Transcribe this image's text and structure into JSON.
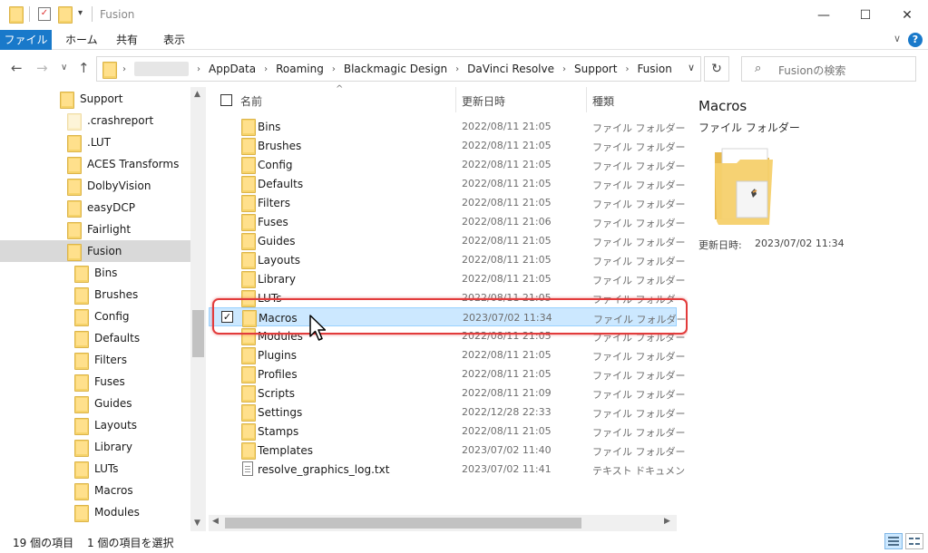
{
  "window": {
    "title": "Fusion",
    "minimize_glyph": "—",
    "maximize_glyph": "☐",
    "close_glyph": "✕"
  },
  "ribbon": {
    "tabs": [
      "ファイル",
      "ホーム",
      "共有",
      "表示"
    ],
    "help_glyph": "?",
    "expand_glyph": "∨"
  },
  "address": {
    "back_glyph": "←",
    "forward_glyph": "→",
    "recent_glyph": "∨",
    "up_glyph": "↑",
    "crumbs": [
      "AppData",
      "Roaming",
      "Blackmagic Design",
      "DaVinci Resolve",
      "Support",
      "Fusion"
    ],
    "crumb_separator": "›",
    "dropdown_glyph": "∨",
    "refresh_glyph": "↻"
  },
  "search": {
    "icon_glyph": "⌕",
    "placeholder": "Fusionの検索"
  },
  "nav": {
    "items": [
      {
        "label": "Support",
        "level": 0,
        "selected": false,
        "faint": false
      },
      {
        "label": ".crashreport",
        "level": 1,
        "selected": false,
        "faint": true
      },
      {
        "label": ".LUT",
        "level": 1,
        "selected": false,
        "faint": false
      },
      {
        "label": "ACES Transforms",
        "level": 1,
        "selected": false,
        "faint": false
      },
      {
        "label": "DolbyVision",
        "level": 1,
        "selected": false,
        "faint": false
      },
      {
        "label": "easyDCP",
        "level": 1,
        "selected": false,
        "faint": false
      },
      {
        "label": "Fairlight",
        "level": 1,
        "selected": false,
        "faint": false
      },
      {
        "label": "Fusion",
        "level": 1,
        "selected": true,
        "faint": false
      },
      {
        "label": "Bins",
        "level": 2,
        "selected": false,
        "faint": false
      },
      {
        "label": "Brushes",
        "level": 2,
        "selected": false,
        "faint": false
      },
      {
        "label": "Config",
        "level": 2,
        "selected": false,
        "faint": false
      },
      {
        "label": "Defaults",
        "level": 2,
        "selected": false,
        "faint": false
      },
      {
        "label": "Filters",
        "level": 2,
        "selected": false,
        "faint": false
      },
      {
        "label": "Fuses",
        "level": 2,
        "selected": false,
        "faint": false
      },
      {
        "label": "Guides",
        "level": 2,
        "selected": false,
        "faint": false
      },
      {
        "label": "Layouts",
        "level": 2,
        "selected": false,
        "faint": false
      },
      {
        "label": "Library",
        "level": 2,
        "selected": false,
        "faint": false
      },
      {
        "label": "LUTs",
        "level": 2,
        "selected": false,
        "faint": false
      },
      {
        "label": "Macros",
        "level": 2,
        "selected": false,
        "faint": false
      },
      {
        "label": "Modules",
        "level": 2,
        "selected": false,
        "faint": false
      }
    ],
    "scroll_up_glyph": "▲",
    "scroll_down_glyph": "▼"
  },
  "list": {
    "columns": {
      "name": "名前",
      "date": "更新日時",
      "type": "種類"
    },
    "sort_glyph": "^",
    "check_glyph": "✓",
    "rows": [
      {
        "name": "Bins",
        "date": "2022/08/11 21:05",
        "type": "ファイル フォルダー",
        "icon": "folder",
        "selected": false
      },
      {
        "name": "Brushes",
        "date": "2022/08/11 21:05",
        "type": "ファイル フォルダー",
        "icon": "folder",
        "selected": false
      },
      {
        "name": "Config",
        "date": "2022/08/11 21:05",
        "type": "ファイル フォルダー",
        "icon": "folder",
        "selected": false
      },
      {
        "name": "Defaults",
        "date": "2022/08/11 21:05",
        "type": "ファイル フォルダー",
        "icon": "folder",
        "selected": false
      },
      {
        "name": "Filters",
        "date": "2022/08/11 21:05",
        "type": "ファイル フォルダー",
        "icon": "folder",
        "selected": false
      },
      {
        "name": "Fuses",
        "date": "2022/08/11 21:06",
        "type": "ファイル フォルダー",
        "icon": "folder",
        "selected": false
      },
      {
        "name": "Guides",
        "date": "2022/08/11 21:05",
        "type": "ファイル フォルダー",
        "icon": "folder",
        "selected": false
      },
      {
        "name": "Layouts",
        "date": "2022/08/11 21:05",
        "type": "ファイル フォルダー",
        "icon": "folder",
        "selected": false
      },
      {
        "name": "Library",
        "date": "2022/08/11 21:05",
        "type": "ファイル フォルダー",
        "icon": "folder",
        "selected": false
      },
      {
        "name": "LUTs",
        "date": "2022/08/11 21:05",
        "type": "ファイル フォルダー",
        "icon": "folder",
        "selected": false
      },
      {
        "name": "Macros",
        "date": "2023/07/02 11:34",
        "type": "ファイル フォルダー",
        "icon": "folder",
        "selected": true
      },
      {
        "name": "Modules",
        "date": "2022/08/11 21:05",
        "type": "ファイル フォルダー",
        "icon": "folder",
        "selected": false
      },
      {
        "name": "Plugins",
        "date": "2022/08/11 21:05",
        "type": "ファイル フォルダー",
        "icon": "folder",
        "selected": false
      },
      {
        "name": "Profiles",
        "date": "2022/08/11 21:05",
        "type": "ファイル フォルダー",
        "icon": "folder",
        "selected": false
      },
      {
        "name": "Scripts",
        "date": "2022/08/11 21:09",
        "type": "ファイル フォルダー",
        "icon": "folder",
        "selected": false
      },
      {
        "name": "Settings",
        "date": "2022/12/28 22:33",
        "type": "ファイル フォルダー",
        "icon": "folder",
        "selected": false
      },
      {
        "name": "Stamps",
        "date": "2022/08/11 21:05",
        "type": "ファイル フォルダー",
        "icon": "folder",
        "selected": false
      },
      {
        "name": "Templates",
        "date": "2023/07/02 11:40",
        "type": "ファイル フォルダー",
        "icon": "folder",
        "selected": false
      },
      {
        "name": "resolve_graphics_log.txt",
        "date": "2023/07/02 11:41",
        "type": "テキスト ドキュメント",
        "icon": "text-file",
        "selected": false
      }
    ],
    "hscroll_left_glyph": "◀",
    "hscroll_right_glyph": "▶"
  },
  "preview": {
    "name": "Macros",
    "type": "ファイル フォルダー",
    "modified_label": "更新日時:",
    "modified_value": "2023/07/02 11:34"
  },
  "status": {
    "item_count": "19 個の項目",
    "selection": "1 個の項目を選択"
  },
  "colors": {
    "accent": "#1979ca",
    "selection_bg": "#cce8ff",
    "highlight_box": "#e23b3b",
    "folder_yellow": "#ffe08c"
  }
}
